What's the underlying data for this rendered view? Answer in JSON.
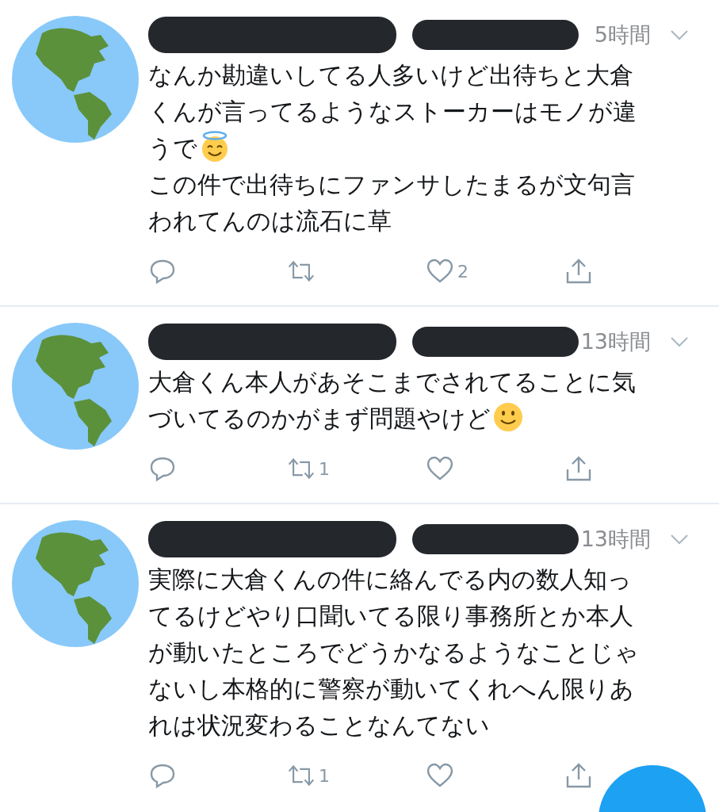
{
  "tweets": [
    {
      "time": "5時間",
      "paragraphs": [
        {
          "lines": [
            "なんか勘違いしてる人多いけど出待ちと大倉",
            "くんが言ってるようなストーカーはモノが違",
            "うで"
          ],
          "kind": "halo_emoji"
        },
        {
          "lines": [
            "この件で出待ちにファンサしたまるが文句言",
            "われてんのは流石に草"
          ]
        }
      ],
      "likes": "2"
    },
    {
      "time": "13時間",
      "paragraphs": [
        {
          "lines": [
            "大倉くん本人があそこまでされてることに気",
            "づいてるのかがまず問題やけど"
          ],
          "kind": "smile_emoji"
        }
      ],
      "retweets": "1"
    },
    {
      "time": "13時間",
      "paragraphs": [
        {
          "lines": [
            "実際に大倉くんの件に絡んでる内の数人知っ",
            "てるけどやり口聞いてる限り事務所とか本人",
            "が動いたところでどうかなるようなことじゃ",
            "ないし本格的に警察が動いてくれへん限りあ",
            "れは状況変わることなんてない"
          ]
        }
      ],
      "retweets": "1"
    }
  ]
}
